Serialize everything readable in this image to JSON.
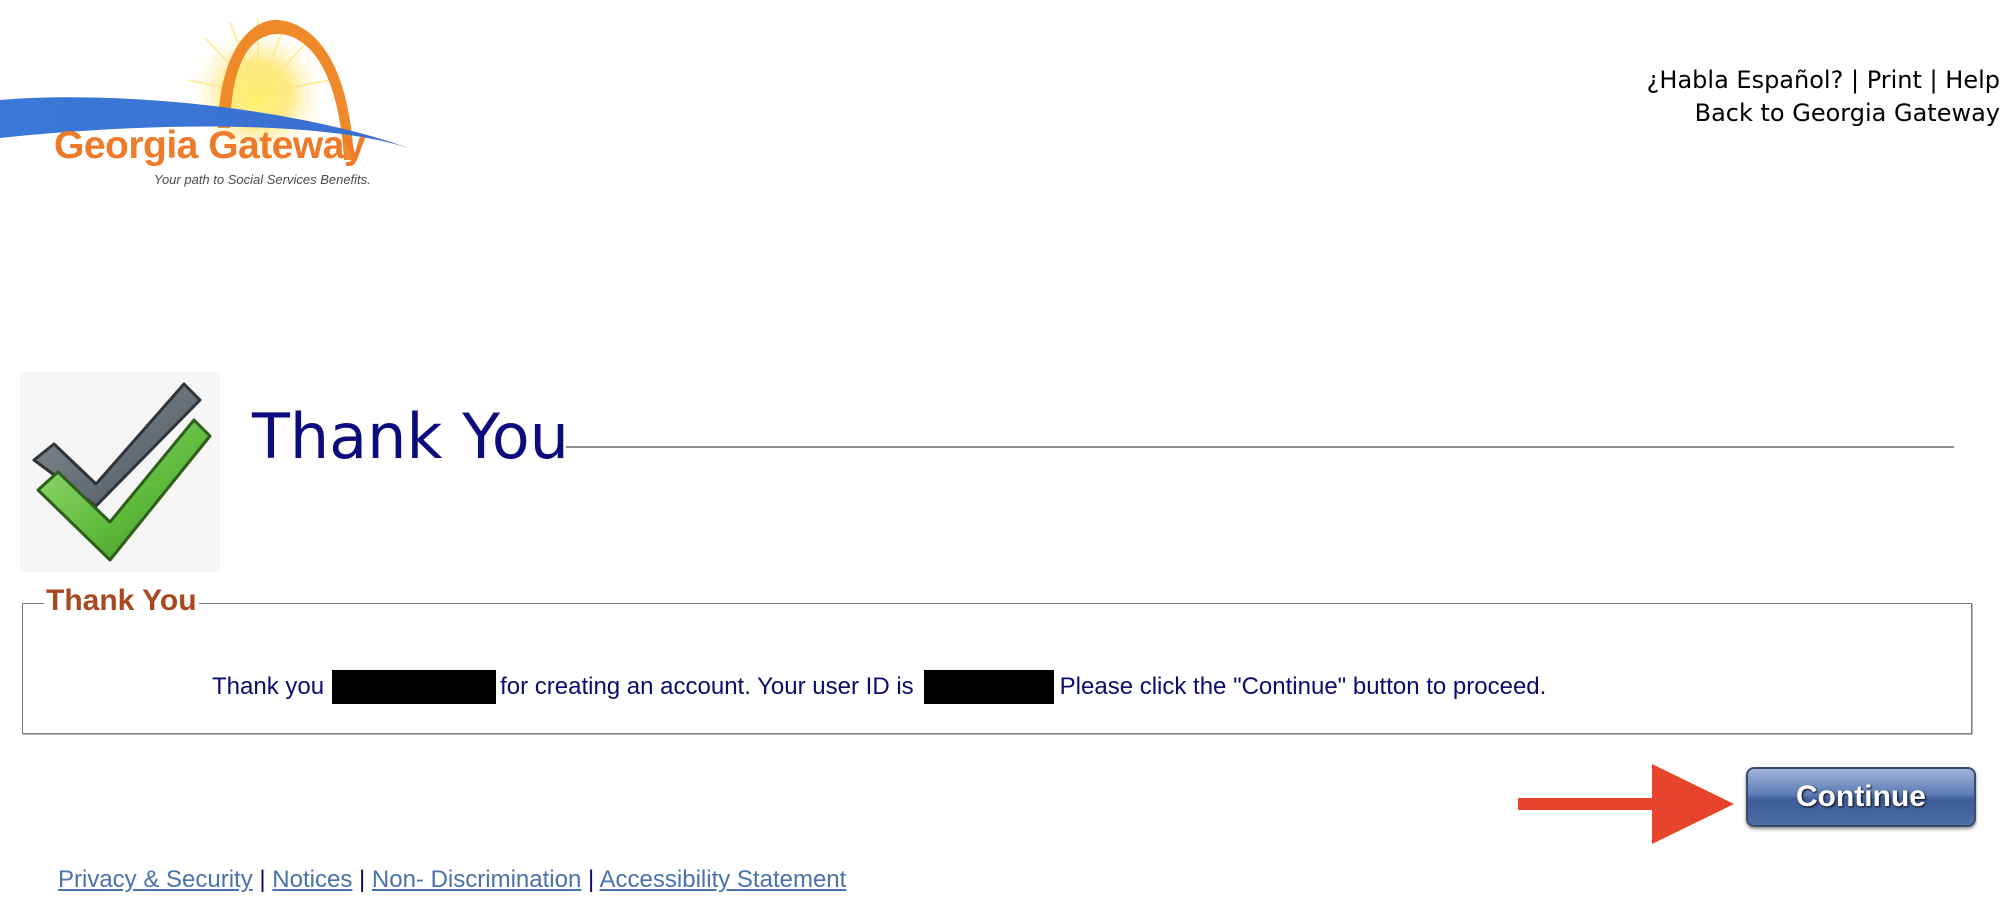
{
  "logo": {
    "name": "Georgia Gateway",
    "tagline": "Your path to Social Services Benefits."
  },
  "top_links": {
    "spanish": "¿Habla Español?",
    "separator": "|",
    "print": "Print",
    "help": "Help",
    "back": "Back to Georgia Gateway"
  },
  "header": {
    "title": "Thank You",
    "icon": "checkmark-icon"
  },
  "panel": {
    "legend": "Thank You",
    "message": {
      "part1": "Thank you",
      "part2": "for creating an account. Your user ID is",
      "part3": "Please click the \"Continue\" button to proceed."
    }
  },
  "actions": {
    "continue_label": "Continue",
    "arrow_icon": "arrow-right-icon"
  },
  "footer": {
    "links": [
      "Privacy & Security",
      "Notices",
      "Non- Discrimination",
      "Accessibility Statement"
    ],
    "separator": "|"
  },
  "colors": {
    "title": "#0c0c7e",
    "legend": "#a8491f",
    "brand_orange": "#ee7a2a",
    "brand_blue": "#3b78d8",
    "arrow": "#e8442c",
    "button": "#4e6da7",
    "footer_link": "#4a72ad"
  }
}
